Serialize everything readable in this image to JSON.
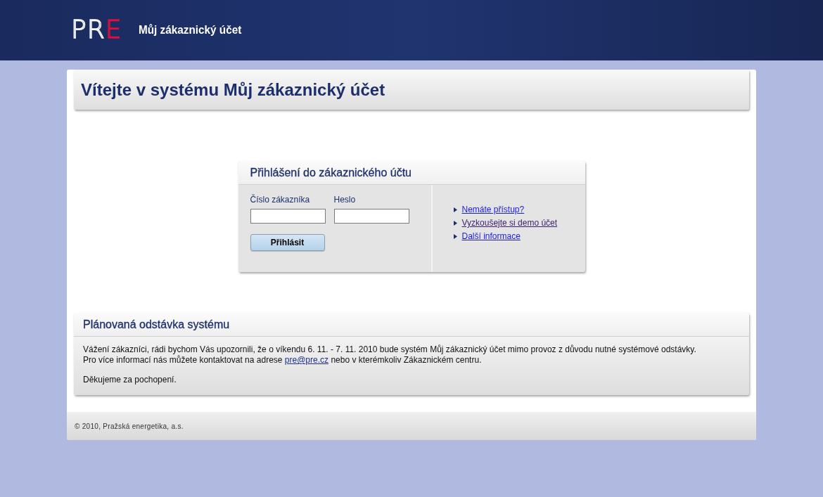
{
  "header": {
    "logo": {
      "main": "PR",
      "accent": "E"
    },
    "title": "Můj zákaznický účet"
  },
  "welcome": {
    "title": "Vítejte v systému Můj zákaznický účet"
  },
  "login": {
    "title": "Přihlášení do zákaznického účtu",
    "fields": [
      {
        "label": "Číslo zákazníka"
      },
      {
        "label": "Heslo"
      }
    ],
    "button": "Přihlásit",
    "links": [
      {
        "label": "Nemáte přístup?",
        "visited": false
      },
      {
        "label": "Vyzkoušejte si demo účet",
        "visited": true
      },
      {
        "label": "Další informace",
        "visited": false
      }
    ]
  },
  "notice": {
    "title": "Plánovaná odstávka systému",
    "line1": "Vážení zákazníci, rádi bychom Vás upozornili, že o víkendu 6. 11. - 7. 11. 2010 bude systém Můj zákaznický účet mimo provoz z důvodu nutné systémové odstávky.",
    "line2_before": "Pro více informací nás můžete kontaktovat na adrese",
    "email": "pre@pre.cz",
    "line2_after": "nebo v kterémkoliv Zákaznickém centru.",
    "thanks": "Děkujeme za pochopení."
  },
  "footer": {
    "copyright": "© 2010, Pražská energetika, a.s."
  }
}
